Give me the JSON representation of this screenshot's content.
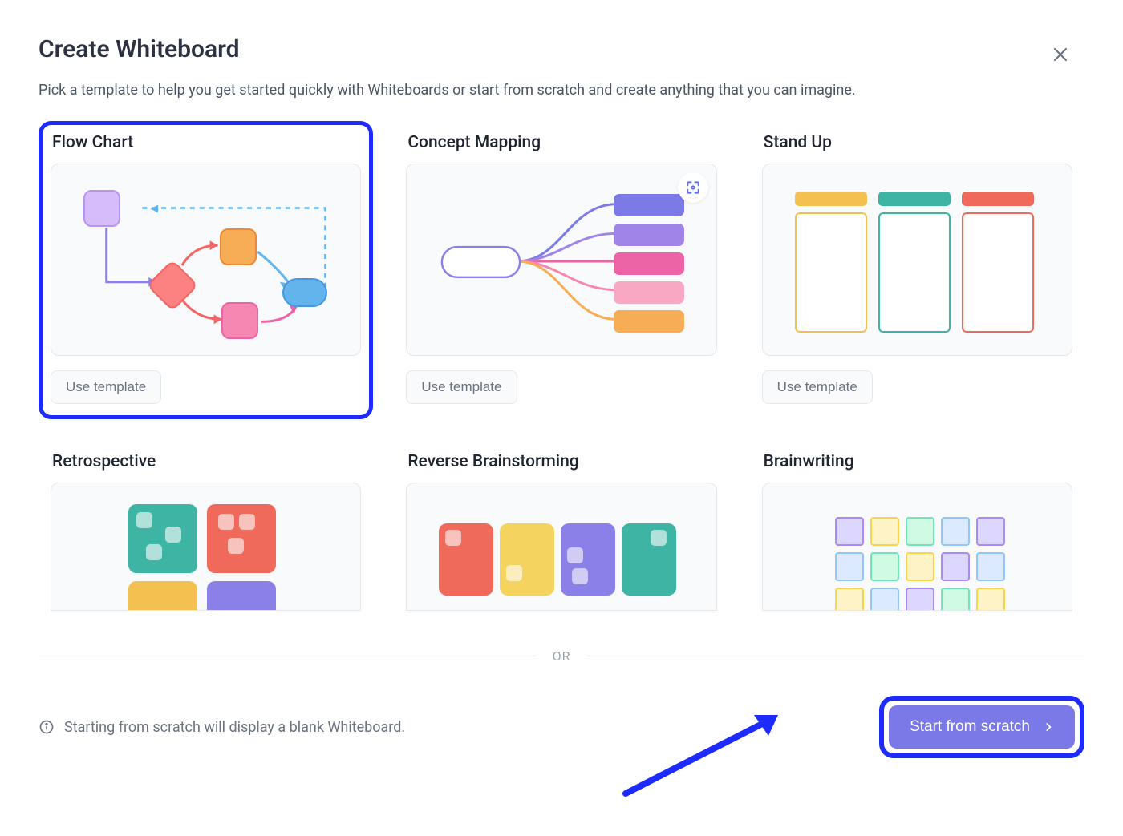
{
  "header": {
    "title": "Create Whiteboard",
    "subtitle": "Pick a template to help you get started quickly with Whiteboards or start from scratch and create anything that you can imagine."
  },
  "templates": [
    {
      "title": "Flow Chart",
      "button": "Use template",
      "highlighted": true
    },
    {
      "title": "Concept Mapping",
      "button": "Use template",
      "highlighted": false
    },
    {
      "title": "Stand Up",
      "button": "Use template",
      "highlighted": false
    },
    {
      "title": "Retrospective",
      "button": "",
      "highlighted": false
    },
    {
      "title": "Reverse Brainstorming",
      "button": "",
      "highlighted": false
    },
    {
      "title": "Brainwriting",
      "button": "",
      "highlighted": false
    }
  ],
  "divider": {
    "label": "OR"
  },
  "footer": {
    "hint": "Starting from scratch will display a blank Whiteboard.",
    "button": "Start from scratch"
  },
  "colors": {
    "highlight": "#1d2bff",
    "primary": "#7b79e8"
  }
}
